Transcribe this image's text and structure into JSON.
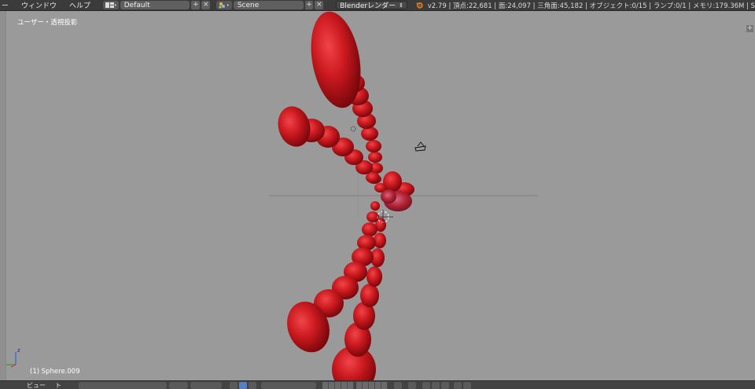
{
  "header": {
    "menus": [
      "ー",
      "ウィンドウ",
      "ヘルプ"
    ],
    "screen_layout": "Default",
    "scene": "Scene",
    "render_engine": "Blenderレンダー",
    "stats": "v2.79 | 頂点:22,681 | 面:24,097 | 三角面:45,182 | オブジェクト:0/15 | ランプ:0/1 | メモリ:179.36M | S"
  },
  "viewport": {
    "view_label": "ユーザー・透視投影",
    "active_object": "(1) Sphere.009",
    "axis_z": "z",
    "background": "#9a9a9a",
    "object_color": "#c0141c"
  },
  "footer": {
    "menus": [
      "ビュー",
      "ト"
    ]
  }
}
